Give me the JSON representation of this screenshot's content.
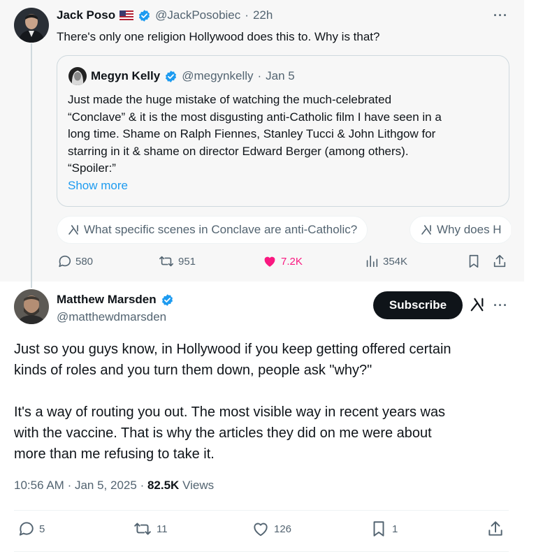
{
  "parent_tweet": {
    "author_name": "Jack Poso",
    "handle": "@JackPosobiec",
    "time": "22h",
    "separator": "·",
    "text": "There's only one religion Hollywood does this to. Why is that?",
    "quote": {
      "author_name": "Megyn Kelly",
      "handle": "@megynkelly",
      "separator": "·",
      "date": "Jan 5",
      "lines": [
        "Just made the huge mistake of watching the much-celebrated",
        "“Conclave” & it is the most disgusting anti-Catholic film I have seen in a",
        "long time. Shame on Ralph Fiennes, Stanley Tucci & John Lithgow for",
        "starring in it & shame on director Edward Berger (among others).",
        "“Spoiler:”"
      ],
      "show_more": "Show more"
    },
    "grok_chips": [
      "What specific scenes in Conclave are anti-Catholic?",
      "Why does H"
    ],
    "actions": {
      "replies": "580",
      "reposts": "951",
      "likes": "7.2K",
      "views": "354K"
    }
  },
  "reply_tweet": {
    "author_name": "Matthew Marsden",
    "handle": "@matthewdmarsden",
    "subscribe_label": "Subscribe",
    "paragraph1": [
      "Just so you guys know, in Hollywood if you keep getting offered certain",
      "kinds of roles and you turn them down, people ask \"why?\""
    ],
    "paragraph2": [
      "It's a way of routing you out. The most visible way in recent years was",
      "with the vaccine. That is why the articles they did on me were about",
      "more than me refusing to take it."
    ],
    "meta": {
      "time": "10:56 AM",
      "date": "Jan 5, 2025",
      "separator": "·",
      "views_count": "82.5K",
      "views_label": "Views"
    },
    "actions": {
      "replies": "5",
      "reposts": "11",
      "likes": "126",
      "bookmarks": "1"
    }
  },
  "colors": {
    "verified": "#1d9bf0",
    "like_active": "#f91880",
    "link": "#1d9bf0",
    "secondary_text": "#536471"
  }
}
